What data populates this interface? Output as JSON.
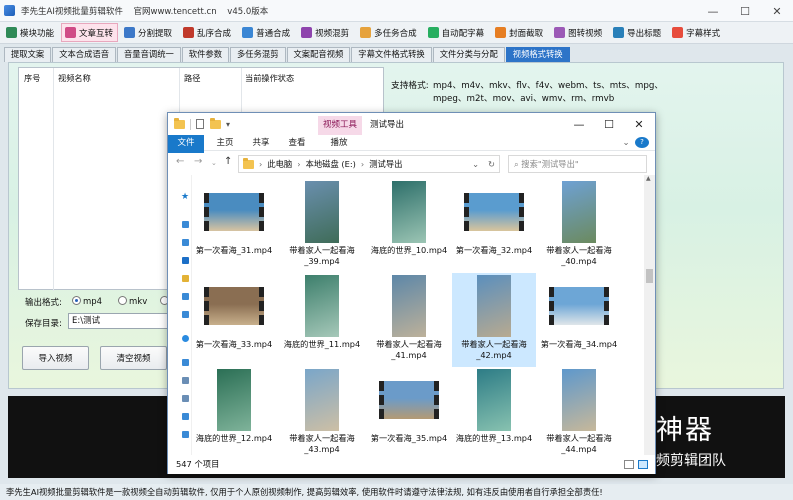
{
  "app": {
    "title": "李先生AI视频批量剪辑软件",
    "website": "官网www.tencett.cn",
    "version": "v45.0版本",
    "window_controls": [
      "—",
      "☐",
      "✕"
    ]
  },
  "toolbar": [
    {
      "label": "模块功能",
      "color": "#2f8a57"
    },
    {
      "label": "文章互转",
      "color": "#d04b86",
      "active": true
    },
    {
      "label": "分割提取",
      "color": "#3c78c8"
    },
    {
      "label": "乱序合成",
      "color": "#c0392b"
    },
    {
      "label": "普通合成",
      "color": "#3a86d4"
    },
    {
      "label": "视频混剪",
      "color": "#8e44ad"
    },
    {
      "label": "多任务合成",
      "color": "#e6a23c"
    },
    {
      "label": "自动配字幕",
      "color": "#27ae60"
    },
    {
      "label": "封面截取",
      "color": "#e67e22"
    },
    {
      "label": "图转视频",
      "color": "#9b59b6"
    },
    {
      "label": "导出标题",
      "color": "#2980b9"
    },
    {
      "label": "字幕样式",
      "color": "#e74c3c"
    }
  ],
  "tabs": [
    {
      "label": "提取文案"
    },
    {
      "label": "文本合成语音"
    },
    {
      "label": "音量音调统一"
    },
    {
      "label": "软件参数"
    },
    {
      "label": "多任务混剪"
    },
    {
      "label": "文案配音视频"
    },
    {
      "label": "字幕文件格式转换"
    },
    {
      "label": "文件分类与分配"
    },
    {
      "label": "视频格式转换",
      "active": true
    }
  ],
  "table": {
    "columns": [
      "序号",
      "视频名称",
      "路径",
      "当前操作状态"
    ]
  },
  "formats": {
    "label": "支持格式:",
    "line1": "mp4、m4v、mkv、flv、f4v、webm、ts、mts、mpg、",
    "line2": "mpeg、m2t、mov、avi、wmv、rm、rmvb"
  },
  "output": {
    "label": "输出格式:",
    "options": [
      "mp4",
      "mkv"
    ],
    "selected": "mp4"
  },
  "save": {
    "label": "保存目录:",
    "value": "E:\\测试"
  },
  "buttons": {
    "import": "导入视频",
    "clear": "清空视频"
  },
  "banner": {
    "big": "神器",
    "small": "频剪辑团队"
  },
  "footer": "李先生AI视频批量剪辑软件是一款视频全自动剪辑软件, 仅用于个人原创视频制作, 提高剪辑效率, 使用软件时请遵守法律法规, 如有违反由使用者自行承担全部责任!",
  "explorer": {
    "context_tab": "视频工具",
    "title": "测试导出",
    "ribbon": {
      "file": "文件",
      "home": "主页",
      "share": "共享",
      "view": "查看",
      "play": "播放"
    },
    "breadcrumb": [
      "此电脑",
      "本地磁盘 (E:)",
      "测试导出"
    ],
    "search_placeholder": "搜索\"测试导出\"",
    "status": "547 个项目",
    "files": [
      {
        "name": "第一次看海_31.mp4",
        "kind": "land",
        "c1": "#4a8cc0",
        "c2": "#d8c4a1"
      },
      {
        "name": "带着家人一起看海_39.mp4",
        "kind": "port",
        "c1": "#6a8fae",
        "c2": "#3f6c58"
      },
      {
        "name": "海底的世界_10.mp4",
        "kind": "port",
        "c1": "#2d6f6a",
        "c2": "#9cc5b4"
      },
      {
        "name": "第一次看海_32.mp4",
        "kind": "land",
        "c1": "#5a9ccf",
        "c2": "#d9c59c"
      },
      {
        "name": "带着家人一起看海_40.mp4",
        "kind": "port",
        "c1": "#6ea1d4",
        "c2": "#6b8a5e"
      },
      {
        "name": "第一次看海_33.mp4",
        "kind": "land",
        "c1": "#8a6e52",
        "c2": "#c8b08c"
      },
      {
        "name": "海底的世界_11.mp4",
        "kind": "port",
        "c1": "#3d7f6c",
        "c2": "#a6c8b9"
      },
      {
        "name": "带着家人一起看海_41.mp4",
        "kind": "port",
        "c1": "#5d87a8",
        "c2": "#bdb19a"
      },
      {
        "name": "带着家人一起看海_42.mp4",
        "kind": "port",
        "c1": "#5b8fbd",
        "c2": "#b8aa90",
        "selected": true
      },
      {
        "name": "第一次看海_34.mp4",
        "kind": "land",
        "c1": "#6da6d6",
        "c2": "#dfe6e9"
      },
      {
        "name": "海底的世界_12.mp4",
        "kind": "port",
        "c1": "#2b6f55",
        "c2": "#7fb39a"
      },
      {
        "name": "带着家人一起看海_43.mp4",
        "kind": "port",
        "c1": "#7aa6c9",
        "c2": "#cdbfa5"
      },
      {
        "name": "第一次看海_35.mp4",
        "kind": "land",
        "c1": "#6b9bc9",
        "c2": "#b49a74"
      },
      {
        "name": "海底的世界_13.mp4",
        "kind": "port",
        "c1": "#2d7c86",
        "c2": "#88c2b0"
      },
      {
        "name": "带着家人一起看海_44.mp4",
        "kind": "port",
        "c1": "#5e98cc",
        "c2": "#c7b89a"
      }
    ]
  }
}
